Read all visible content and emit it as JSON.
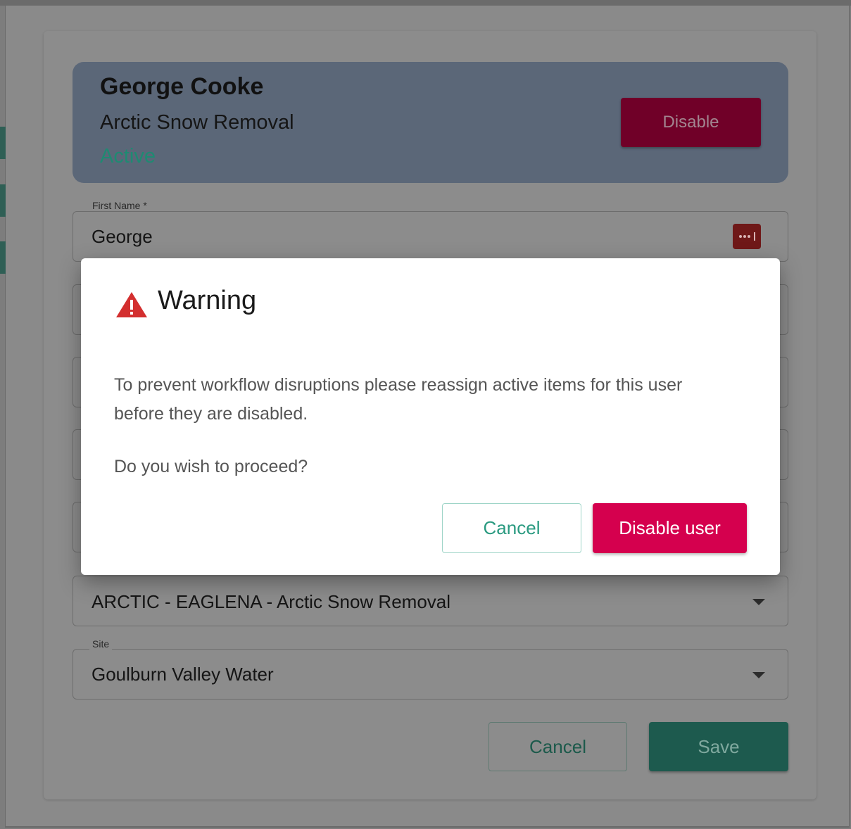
{
  "user_header": {
    "name": "George Cooke",
    "company": "Arctic Snow Removal",
    "status": "Active",
    "disable_label": "Disable"
  },
  "form": {
    "first_name": {
      "label": "First Name *",
      "value": "George"
    },
    "company_select": {
      "value": "ARCTIC - EAGLENA - Arctic Snow Removal"
    },
    "site_select": {
      "label": "Site",
      "value": "Goulburn Valley Water"
    },
    "cancel_label": "Cancel",
    "save_label": "Save"
  },
  "dialog": {
    "title": "Warning",
    "message": "To prevent workflow disruptions please reassign active items for this user before they are disabled.",
    "question": "Do you wish to proceed?",
    "cancel_label": "Cancel",
    "confirm_label": "Disable user"
  },
  "icons": {
    "warning": "warning-triangle-icon",
    "password_manager": "password-dots-icon",
    "dropdown": "chevron-down-icon"
  },
  "colors": {
    "danger": "#d5004e",
    "success": "#1f8a72",
    "accent_teal": "#2a9a80",
    "warning_icon": "#d32f2f"
  }
}
